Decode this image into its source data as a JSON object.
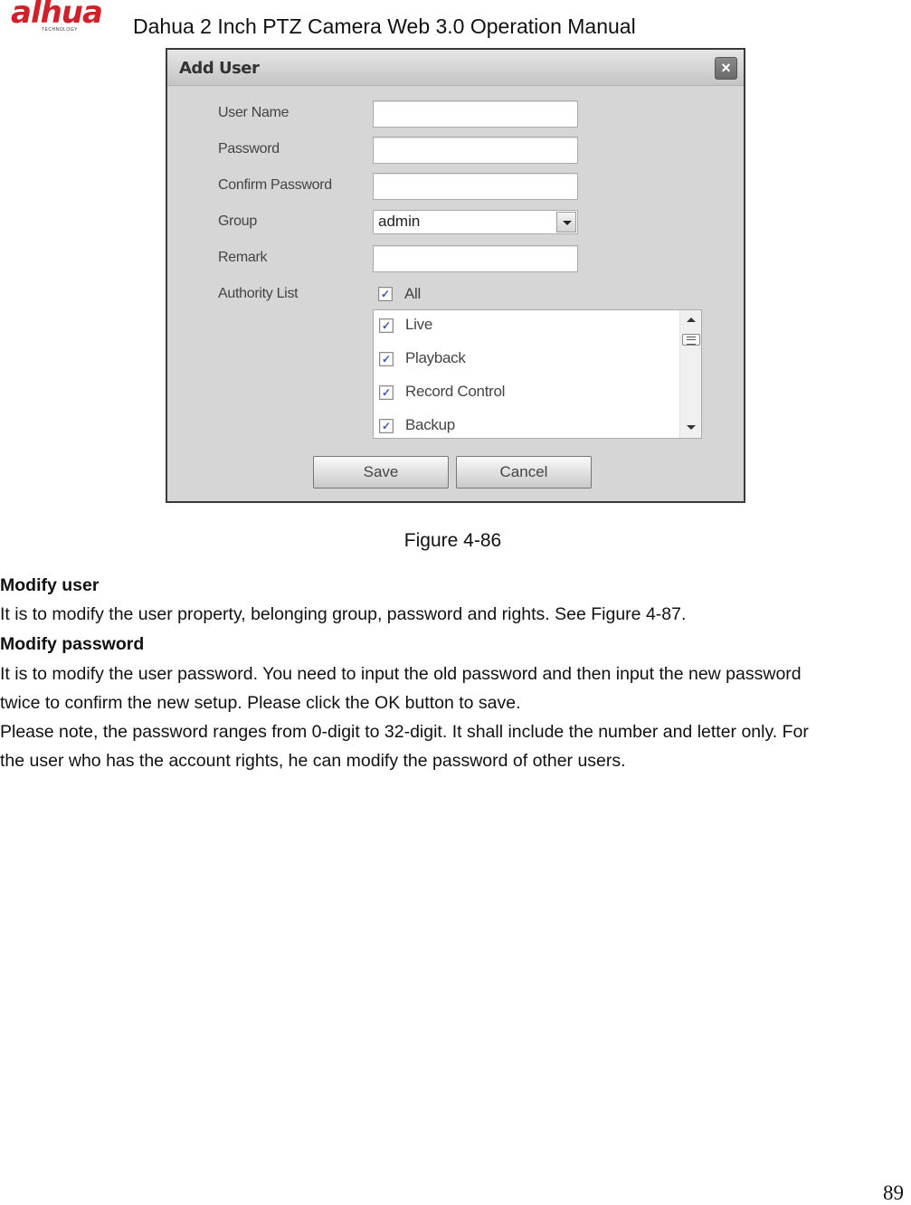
{
  "header": {
    "logo_text": "alhua",
    "logo_subtext": "TECHNOLOGY",
    "title": "Dahua 2 Inch PTZ Camera Web 3.0 Operation Manual"
  },
  "dialog": {
    "title": "Add User",
    "close_icon": "close-icon",
    "fields": [
      {
        "label": "User Name",
        "value": ""
      },
      {
        "label": "Password",
        "value": ""
      },
      {
        "label": "Confirm Password",
        "value": ""
      },
      {
        "label": "Group",
        "value": "admin"
      },
      {
        "label": "Remark",
        "value": ""
      }
    ],
    "authority": {
      "label": "Authority List",
      "all_label": "All",
      "all_checked": true,
      "items": [
        {
          "label": "Live",
          "checked": true
        },
        {
          "label": "Playback",
          "checked": true
        },
        {
          "label": "Record Control",
          "checked": true
        },
        {
          "label": "Backup",
          "checked": true
        }
      ]
    },
    "save_label": "Save",
    "cancel_label": "Cancel"
  },
  "document": {
    "caption": "Figure 4-86",
    "heading1": "Modify user",
    "para1": "It is to modify the user property, belonging group, password and rights. See Figure 4-87.",
    "heading2": "Modify password",
    "para2_line1": "It is to modify the user password. You need to input the old password and then input the new password",
    "para2_line2": "twice to confirm the new setup. Please click the OK button to save.",
    "para3_line1": "Please note, the password ranges from 0-digit to 32-digit. It shall include the number and letter only. For",
    "para3_line2": "the user who has the account rights, he can modify the password of other users.",
    "page_number": "89"
  },
  "check_glyph": "✓",
  "close_glyph": "×"
}
